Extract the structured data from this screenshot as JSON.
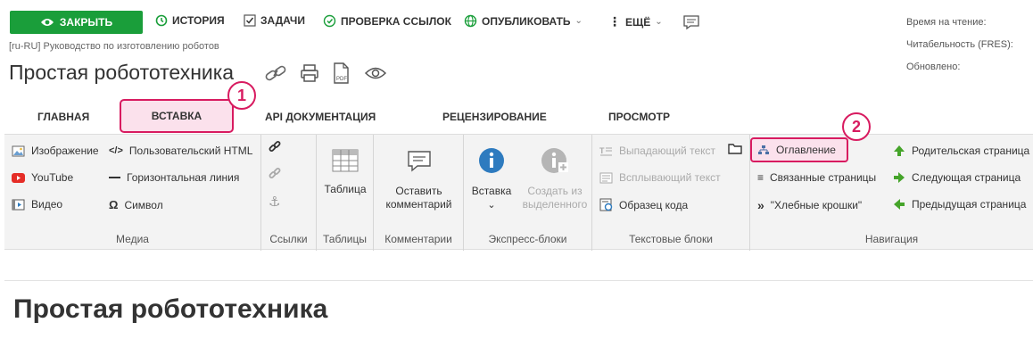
{
  "toolbar": {
    "close_label": "ЗАКРЫТЬ",
    "history_label": "ИСТОРИЯ",
    "tasks_label": "ЗАДАЧИ",
    "links_check_label": "ПРОВЕРКА ССЫЛОК",
    "publish_label": "ОПУБЛИКОВАТЬ",
    "more_label": "ЕЩЁ"
  },
  "meta": {
    "read_time": "Время на чтение:",
    "readability": "Читабельность (FRES):",
    "updated": "Обновлено:"
  },
  "breadcrumb": "[ru-RU] Руководство по изготовлению роботов",
  "page_title": "Простая робототехника",
  "tabs": {
    "home": "ГЛАВНАЯ",
    "insert": "ВСТАВКА",
    "api": "API ДОКУМЕНТАЦИЯ",
    "review": "РЕЦЕНЗИРОВАНИЕ",
    "view": "ПРОСМОТР"
  },
  "badges": {
    "one": "1",
    "two": "2"
  },
  "ribbon": {
    "media": {
      "label": "Медиа",
      "image": "Изображение",
      "youtube": "YouTube",
      "video": "Видео",
      "custom_html": "Пользовательский HTML",
      "hline": "Горизонтальная линия",
      "symbol": "Символ"
    },
    "links": {
      "label": "Ссылки"
    },
    "tables": {
      "label": "Таблицы",
      "table": "Таблица"
    },
    "comments": {
      "label": "Комментарии",
      "leave_line1": "Оставить",
      "leave_line2": "комментарий"
    },
    "express": {
      "label": "Экспресс-блоки",
      "insert": "Вставка",
      "create_line1": "Создать из",
      "create_line2": "выделенного"
    },
    "text_blocks": {
      "label": "Текстовые блоки",
      "dropdown": "Выпадающий текст",
      "popup": "Всплывающий текст",
      "code_sample": "Образец кода"
    },
    "navigation": {
      "label": "Навигация",
      "toc": "Оглавление",
      "related": "Связанные страницы",
      "breadcrumbs": "\"Хлебные крошки\"",
      "parent": "Родительская страница",
      "next": "Следующая страница",
      "prev": "Предыдущая страница"
    }
  },
  "content_title": "Простая робототехника",
  "colors": {
    "accent_green": "#1a9e3a",
    "highlight": "#d81b60",
    "info_blue": "#2e7bbf"
  }
}
